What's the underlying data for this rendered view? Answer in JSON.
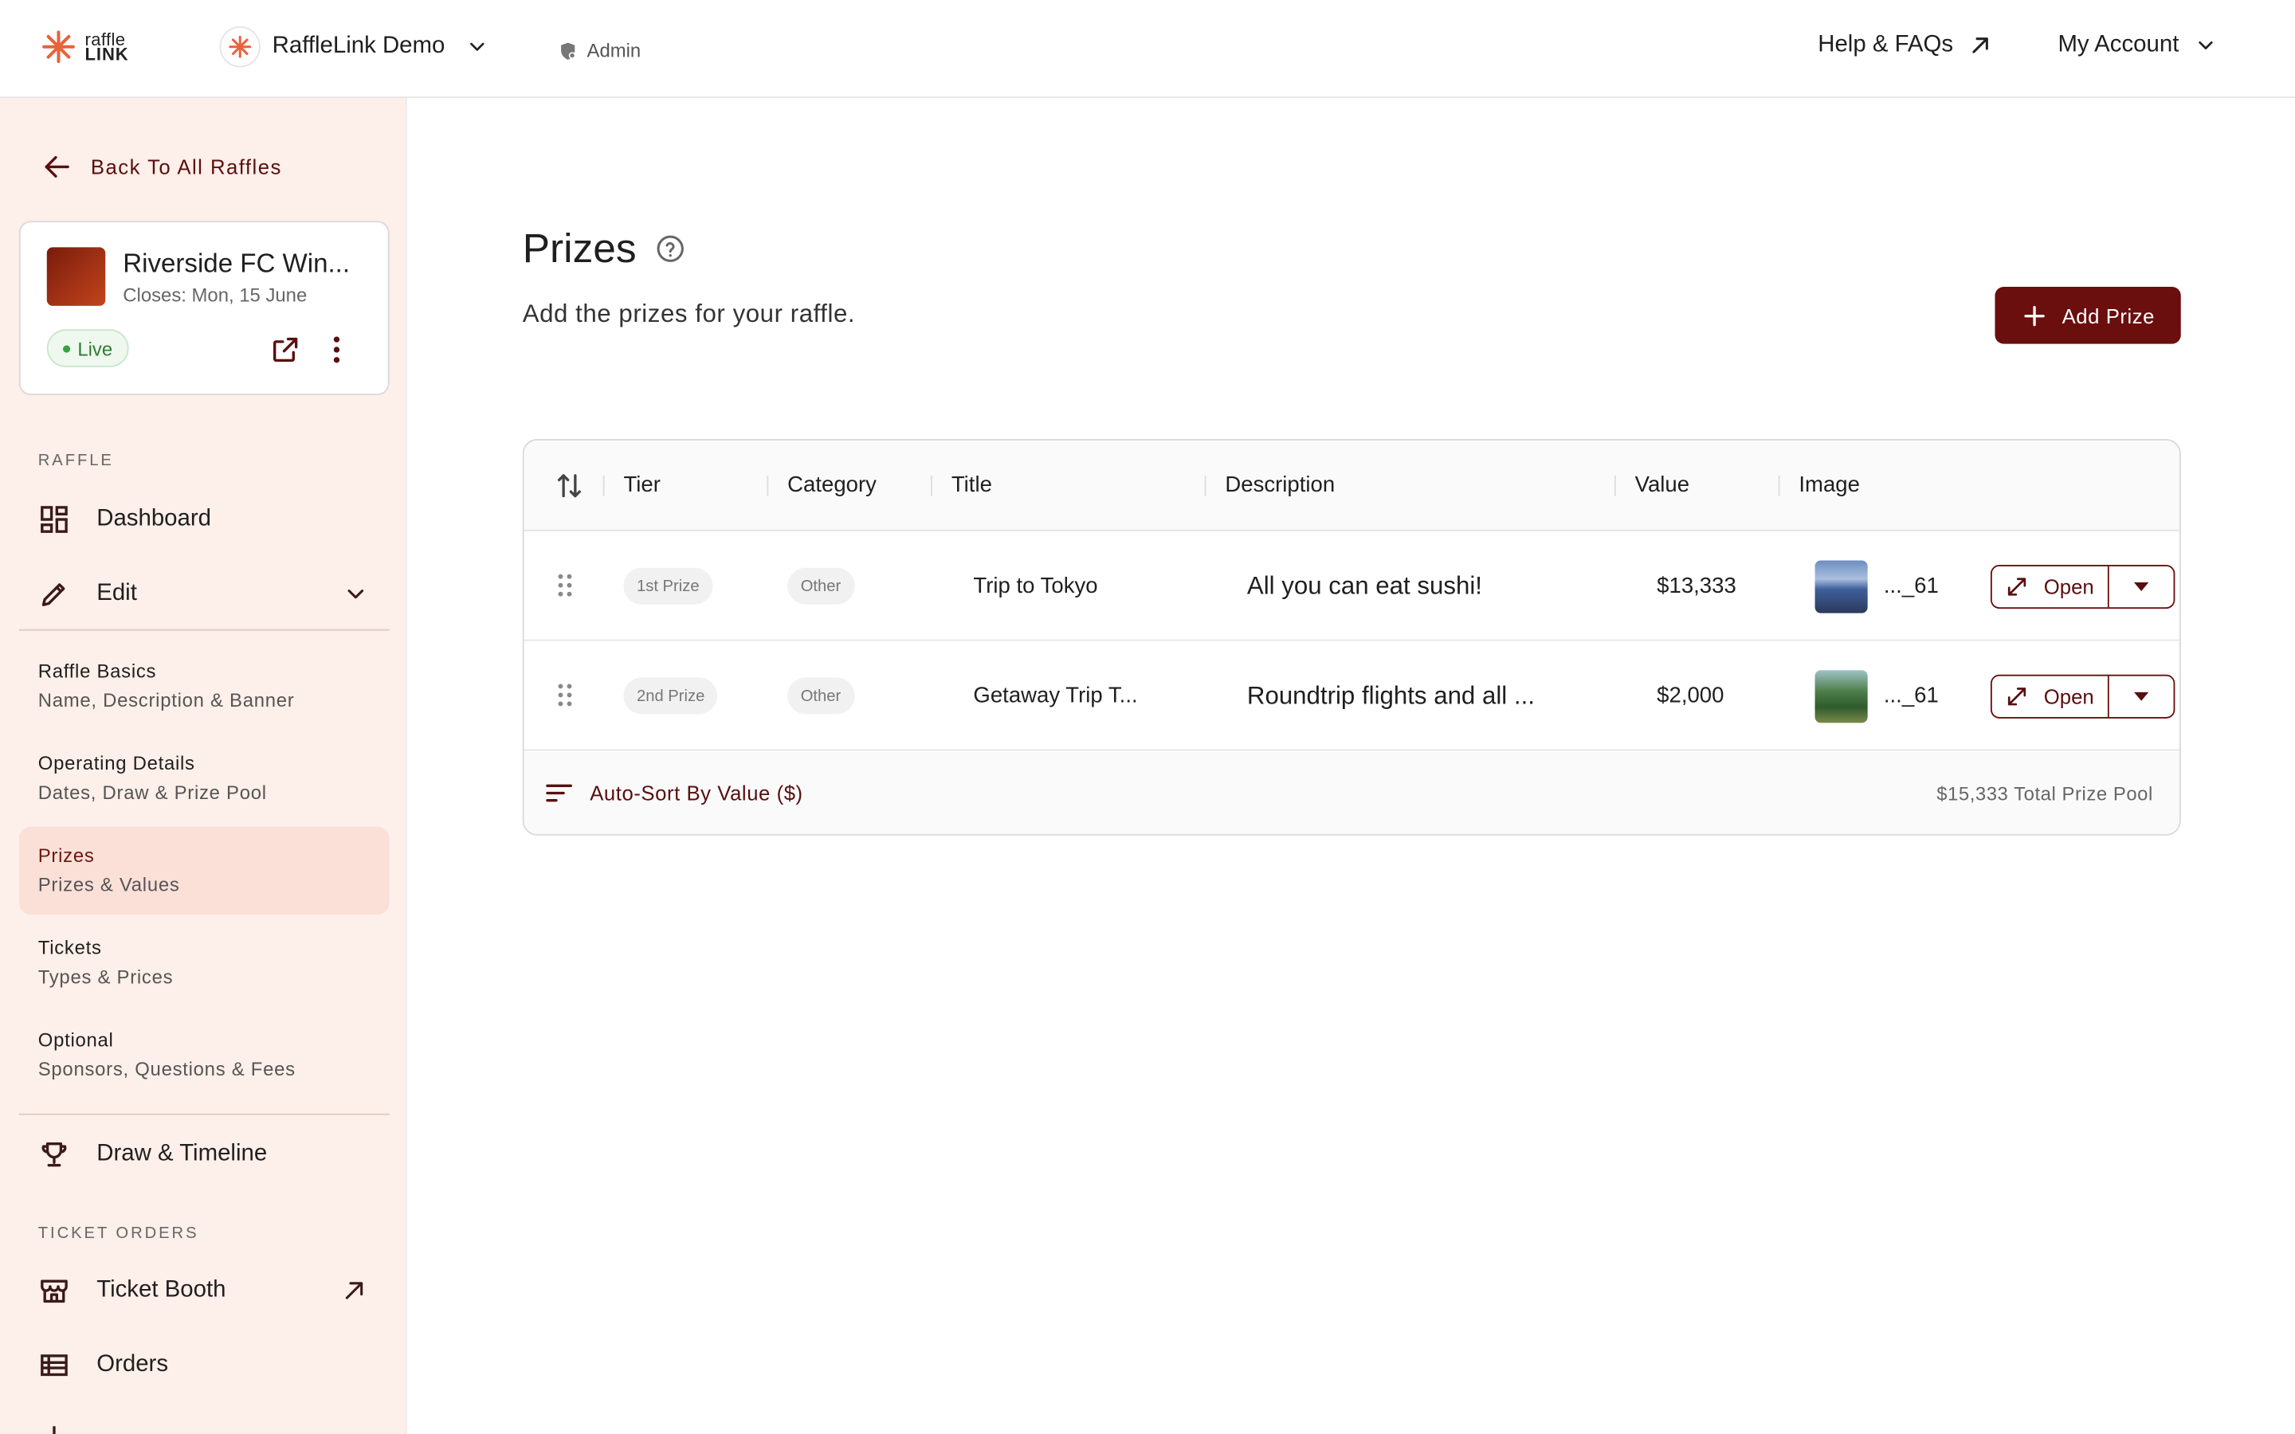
{
  "brand": {
    "line1": "raffle",
    "line2": "LINK",
    "accent": "#e8623a"
  },
  "header": {
    "org_name": "RaffleLink Demo",
    "role": "Admin",
    "help_label": "Help & FAQs",
    "account_label": "My Account"
  },
  "sidebar": {
    "back_label": "Back To All Raffles",
    "raffle": {
      "name": "Riverside FC Win...",
      "closes": "Closes: Mon, 15 June",
      "status": "Live"
    },
    "section_raffle": "RAFFLE",
    "dashboard": "Dashboard",
    "edit": "Edit",
    "sub_items": [
      {
        "title": "Raffle Basics",
        "subtitle": "Name, Description & Banner"
      },
      {
        "title": "Operating Details",
        "subtitle": "Dates, Draw & Prize Pool"
      },
      {
        "title": "Prizes",
        "subtitle": "Prizes & Values"
      },
      {
        "title": "Tickets",
        "subtitle": "Types & Prices"
      },
      {
        "title": "Optional",
        "subtitle": "Sponsors, Questions & Fees"
      }
    ],
    "draw_timeline": "Draw & Timeline",
    "section_orders": "TICKET ORDERS",
    "ticket_booth": "Ticket Booth",
    "orders": "Orders"
  },
  "main": {
    "title": "Prizes",
    "subtitle": "Add the prizes for your raffle.",
    "add_button": "Add Prize",
    "columns": [
      "Tier",
      "Category",
      "Title",
      "Description",
      "Value",
      "Image"
    ],
    "rows": [
      {
        "tier": "1st Prize",
        "category": "Other",
        "title": "Trip to Tokyo",
        "description": "All you can eat sushi!",
        "value": "$13,333",
        "image": "..._61",
        "open": "Open"
      },
      {
        "tier": "2nd Prize",
        "category": "Other",
        "title": "Getaway Trip T...",
        "description": "Roundtrip flights and all ...",
        "value": "$2,000",
        "image": "..._61",
        "open": "Open"
      }
    ],
    "autosort_label": "Auto-Sort By Value ($)",
    "total_label": "$15,333 Total Prize Pool"
  },
  "colors": {
    "primary": "#6b0e0e",
    "sidebar_bg": "#fdefe9",
    "active_bg": "#fbe0d8",
    "live": "#2e7d32"
  }
}
